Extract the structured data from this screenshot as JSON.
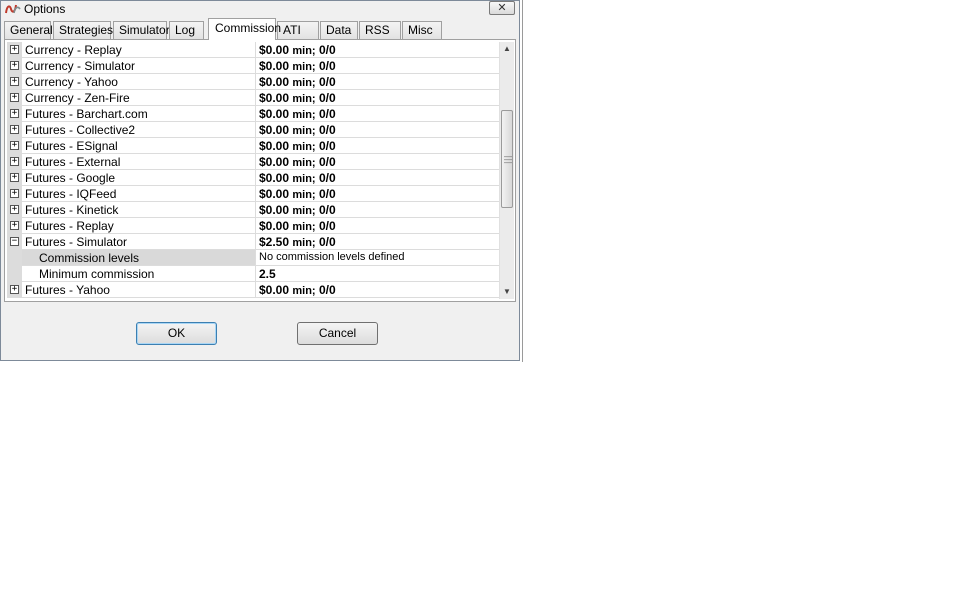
{
  "window": {
    "title": "Options",
    "close_label": "✕"
  },
  "tabs": [
    {
      "label": "General",
      "active": false
    },
    {
      "label": "Strategies",
      "active": false
    },
    {
      "label": "Simulator",
      "active": false
    },
    {
      "label": "Log",
      "active": false
    },
    {
      "label": "Commission",
      "active": true
    },
    {
      "label": "ATI",
      "active": false
    },
    {
      "label": "Data",
      "active": false
    },
    {
      "label": "RSS",
      "active": false
    },
    {
      "label": "Misc",
      "active": false
    }
  ],
  "grid": {
    "rows": [
      {
        "name": "Currency - Replay",
        "amount": "$0.00",
        "min_label": "min;",
        "ratio": "0/0",
        "expanded": false
      },
      {
        "name": "Currency - Simulator",
        "amount": "$0.00",
        "min_label": "min;",
        "ratio": "0/0",
        "expanded": false
      },
      {
        "name": "Currency - Yahoo",
        "amount": "$0.00",
        "min_label": "min;",
        "ratio": "0/0",
        "expanded": false
      },
      {
        "name": "Currency - Zen-Fire",
        "amount": "$0.00",
        "min_label": "min;",
        "ratio": "0/0",
        "expanded": false
      },
      {
        "name": "Futures - Barchart.com",
        "amount": "$0.00",
        "min_label": "min;",
        "ratio": "0/0",
        "expanded": false
      },
      {
        "name": "Futures - Collective2",
        "amount": "$0.00",
        "min_label": "min;",
        "ratio": "0/0",
        "expanded": false
      },
      {
        "name": "Futures - ESignal",
        "amount": "$0.00",
        "min_label": "min;",
        "ratio": "0/0",
        "expanded": false
      },
      {
        "name": "Futures - External",
        "amount": "$0.00",
        "min_label": "min;",
        "ratio": "0/0",
        "expanded": false
      },
      {
        "name": "Futures - Google",
        "amount": "$0.00",
        "min_label": "min;",
        "ratio": "0/0",
        "expanded": false
      },
      {
        "name": "Futures - IQFeed",
        "amount": "$0.00",
        "min_label": "min;",
        "ratio": "0/0",
        "expanded": false
      },
      {
        "name": "Futures - Kinetick",
        "amount": "$0.00",
        "min_label": "min;",
        "ratio": "0/0",
        "expanded": false
      },
      {
        "name": "Futures - Replay",
        "amount": "$0.00",
        "min_label": "min;",
        "ratio": "0/0",
        "expanded": false
      },
      {
        "name": "Futures - Simulator",
        "amount": "$2.50",
        "min_label": "min;",
        "ratio": "0/0",
        "expanded": true,
        "children": [
          {
            "name": "Commission levels",
            "value": "No commission levels defined",
            "selected": true,
            "bold": false
          },
          {
            "name": "Minimum commission",
            "value": "2.5",
            "selected": false,
            "bold": true
          }
        ]
      },
      {
        "name": "Futures - Yahoo",
        "amount": "$0.00",
        "min_label": "min;",
        "ratio": "0/0",
        "expanded": false
      }
    ]
  },
  "icons": {
    "expand": "plus-box-icon",
    "collapse": "minus-box-icon",
    "scroll_up": "arrow-up-icon",
    "scroll_down": "arrow-down-icon"
  },
  "buttons": {
    "ok": "OK",
    "cancel": "Cancel"
  },
  "colors": {
    "accent": "#3c7fb1",
    "selected_row": "#d9d9d9",
    "window_bg": "#f0f0f0"
  }
}
